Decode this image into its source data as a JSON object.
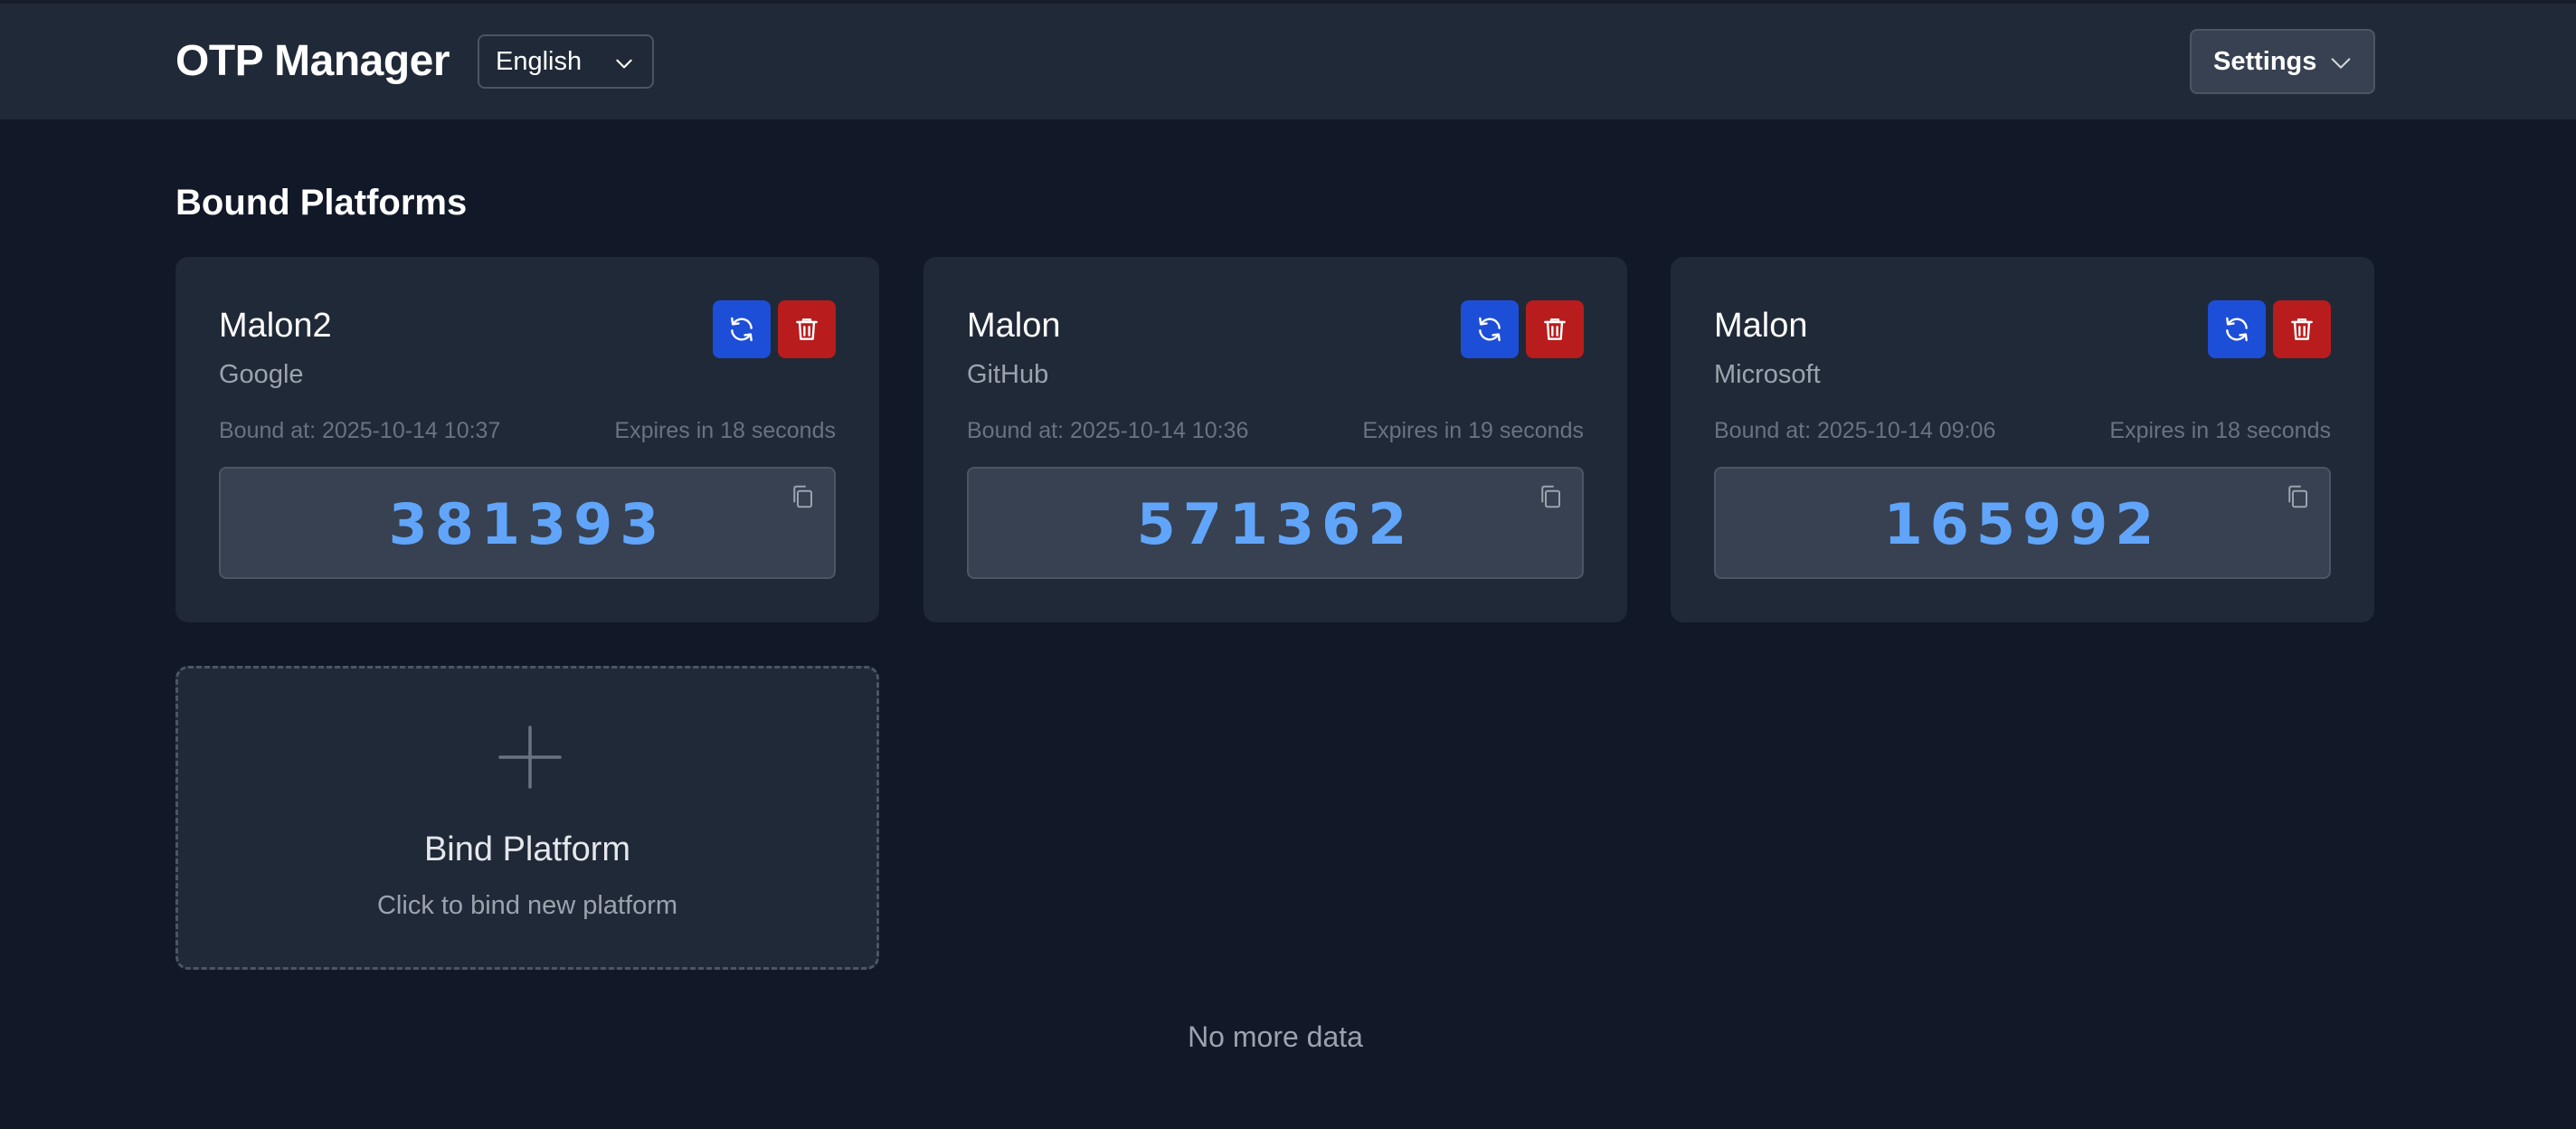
{
  "header": {
    "title": "OTP Manager",
    "language": "English",
    "settings_label": "Settings"
  },
  "section": {
    "title": "Bound Platforms"
  },
  "cards": [
    {
      "name": "Malon2",
      "platform": "Google",
      "bound_at": "Bound at: 2025-10-14 10:37",
      "expires": "Expires in 18 seconds",
      "code": "381393"
    },
    {
      "name": "Malon",
      "platform": "GitHub",
      "bound_at": "Bound at: 2025-10-14 10:36",
      "expires": "Expires in 19 seconds",
      "code": "571362"
    },
    {
      "name": "Malon",
      "platform": "Microsoft",
      "bound_at": "Bound at: 2025-10-14 09:06",
      "expires": "Expires in 18 seconds",
      "code": "165992"
    }
  ],
  "bind": {
    "title": "Bind Platform",
    "subtitle": "Click to bind new platform"
  },
  "footer": {
    "text": "No more data"
  },
  "icons": {
    "refresh": "refresh-icon",
    "delete": "trash-icon",
    "copy": "copy-icon",
    "add": "plus-icon",
    "dropdown": "chevron-down-icon"
  },
  "colors": {
    "background": "#111827",
    "surface": "#1f2937",
    "otp_code": "#60a5fa",
    "refresh_button": "#1d4ed8",
    "delete_button": "#b91c1c"
  }
}
